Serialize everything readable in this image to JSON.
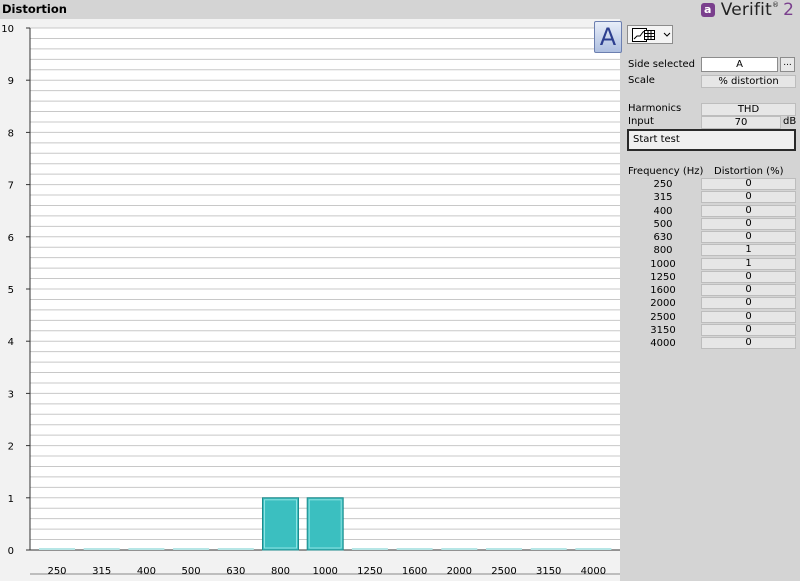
{
  "window": {
    "title": "Distortion"
  },
  "brand": {
    "logo_letter": "a",
    "name": "Verifit",
    "mark": "®",
    "version": "2"
  },
  "chart_data": {
    "type": "bar",
    "categories": [
      "250",
      "315",
      "400",
      "500",
      "630",
      "800",
      "1000",
      "1250",
      "1600",
      "2000",
      "2500",
      "3150",
      "4000"
    ],
    "values": [
      0,
      0,
      0,
      0,
      0,
      1,
      1,
      0,
      0,
      0,
      0,
      0,
      0
    ],
    "ylim": [
      0,
      10
    ],
    "yticks": [
      "0",
      "1",
      "2",
      "3",
      "4",
      "5",
      "6",
      "7",
      "8",
      "9",
      "10"
    ],
    "grid": true,
    "bar_color": "#3bbfc0"
  },
  "chart": {
    "side_button": "A"
  },
  "panel": {
    "side_selected_label": "Side selected",
    "side_selected_value": "A",
    "ellipsis": "...",
    "scale_label": "Scale",
    "scale_value": "% distortion",
    "harmonics_label": "Harmonics",
    "harmonics_value": "THD",
    "input_label": "Input",
    "input_value": "70",
    "input_unit": "dB",
    "start_test": "Start test",
    "col_frequency": "Frequency (Hz)",
    "col_distortion": "Distortion (%)",
    "rows": [
      {
        "freq": "250",
        "dist": "0"
      },
      {
        "freq": "315",
        "dist": "0"
      },
      {
        "freq": "400",
        "dist": "0"
      },
      {
        "freq": "500",
        "dist": "0"
      },
      {
        "freq": "630",
        "dist": "0"
      },
      {
        "freq": "800",
        "dist": "1"
      },
      {
        "freq": "1000",
        "dist": "1"
      },
      {
        "freq": "1250",
        "dist": "0"
      },
      {
        "freq": "1600",
        "dist": "0"
      },
      {
        "freq": "2000",
        "dist": "0"
      },
      {
        "freq": "2500",
        "dist": "0"
      },
      {
        "freq": "3150",
        "dist": "0"
      },
      {
        "freq": "4000",
        "dist": "0"
      }
    ]
  }
}
